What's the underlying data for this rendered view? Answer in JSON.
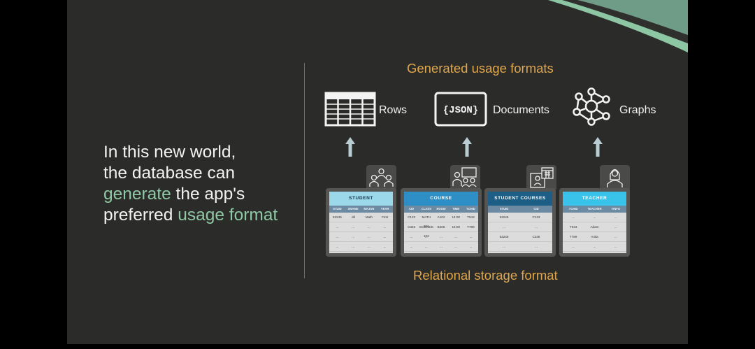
{
  "headline": {
    "line1": "In this new world,",
    "line2": "the database can",
    "hl1": "generate",
    "line3_rest": " the app's",
    "line4_start": "preferred ",
    "hl2": "usage format"
  },
  "top_heading": "Generated usage formats",
  "bottom_heading": "Relational storage format",
  "formats": [
    {
      "label": "Rows",
      "icon": "table-grid-icon"
    },
    {
      "label": "Documents",
      "icon": "json-document-icon",
      "badge": "{JSON}"
    },
    {
      "label": "Graphs",
      "icon": "graph-network-icon"
    }
  ],
  "tables": [
    {
      "title": "STUDENT",
      "icon": "student-group-icon",
      "header_color": "#9bd9ea",
      "title_color": "#17324a",
      "columns": [
        "STUID",
        "SNAME",
        "MAJOR",
        "YEAR"
      ],
      "rows": [
        [
          "53245",
          "Jill",
          "Math",
          "First"
        ],
        [
          "...",
          "...",
          "...",
          "..."
        ],
        [
          "...",
          "...",
          "...",
          "..."
        ],
        [
          "...",
          "...",
          "...",
          "..."
        ]
      ]
    },
    {
      "title": "COURSE",
      "icon": "classroom-presentation-icon",
      "header_color": "#2e8fc7",
      "title_color": "#ffffff",
      "columns": [
        "CID",
        "CLASS",
        "ROOM",
        "TIME",
        "TCHID"
      ],
      "rows": [
        [
          "C123",
          "MATH 201",
          "A102",
          "14:00",
          "T543"
        ],
        [
          "C345",
          "SCIENCE 102",
          "B405",
          "16:00",
          "T789"
        ],
        [
          "...",
          "...",
          "...",
          "...",
          "..."
        ],
        [
          "...",
          "...",
          "...",
          "...",
          "..."
        ]
      ]
    },
    {
      "title": "STUDENT COURSES",
      "icon": "student-calendar-icon",
      "header_color": "#1c5e86",
      "title_color": "#ffffff",
      "columns": [
        "STUID",
        "CID"
      ],
      "rows": [
        [
          "53245",
          "C123"
        ],
        [
          "...",
          "..."
        ],
        [
          "53245",
          "C345"
        ],
        [
          "...",
          "..."
        ]
      ]
    },
    {
      "title": "TEACHER",
      "icon": "teacher-icon",
      "header_color": "#39c3ea",
      "title_color": "#ffffff",
      "columns": [
        "TCHID",
        "TEACHER",
        "TINFO"
      ],
      "rows": [
        [
          "...",
          "...",
          "..."
        ],
        [
          "T543",
          "Adam",
          "..."
        ],
        [
          "T789",
          "Anita",
          "..."
        ],
        [
          "...",
          "...",
          "..."
        ]
      ]
    }
  ],
  "colors": {
    "slide_bg": "#2b2b2a",
    "accent_green": "#8fc8a4",
    "heading_orange": "#e0a84e",
    "arrow": "#b9ccd2"
  }
}
